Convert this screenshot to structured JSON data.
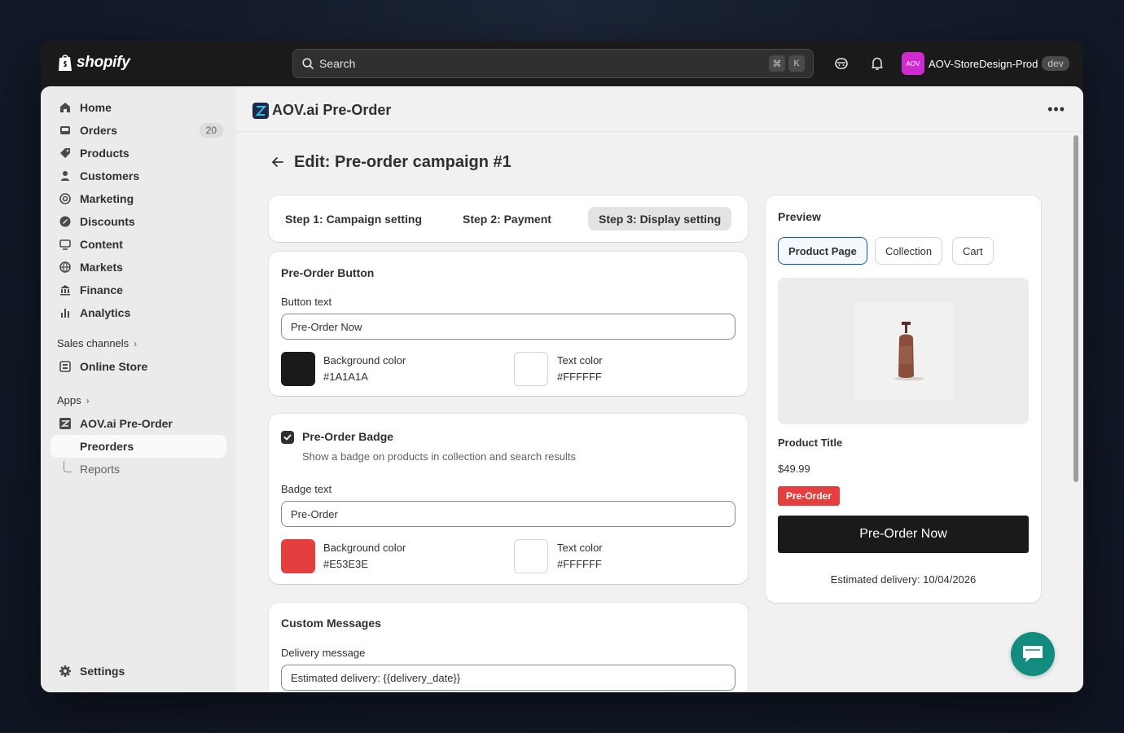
{
  "topbar": {
    "brand": "shopify",
    "search_placeholder": "Search",
    "shortcut_keys": [
      "⌘",
      "K"
    ],
    "store_avatar_text": "AOV",
    "store_name": "AOV-StoreDesign-Prod",
    "store_tag": "dev"
  },
  "sidebar": {
    "items": [
      {
        "label": "Home",
        "icon": "home-icon"
      },
      {
        "label": "Orders",
        "icon": "inbox-icon",
        "count": "20"
      },
      {
        "label": "Products",
        "icon": "tag-icon"
      },
      {
        "label": "Customers",
        "icon": "person-icon"
      },
      {
        "label": "Marketing",
        "icon": "target-icon"
      },
      {
        "label": "Discounts",
        "icon": "discount-icon"
      },
      {
        "label": "Content",
        "icon": "monitor-icon"
      },
      {
        "label": "Markets",
        "icon": "globe-icon"
      },
      {
        "label": "Finance",
        "icon": "bank-icon"
      },
      {
        "label": "Analytics",
        "icon": "bar-chart-icon"
      }
    ],
    "sales_channels_label": "Sales channels",
    "online_store_label": "Online Store",
    "apps_label": "Apps",
    "app_label": "AOV.ai Pre-Order",
    "preorders_label": "Preorders",
    "reports_label": "Reports",
    "settings_label": "Settings"
  },
  "app_header": {
    "title": "AOV.ai Pre-Order"
  },
  "page": {
    "title": "Edit: Pre-order campaign #1",
    "steps": [
      "Step 1: Campaign setting",
      "Step 2: Payment",
      "Step 3: Display setting"
    ],
    "active_step": 2
  },
  "preorder_button": {
    "title": "Pre-Order Button",
    "button_text_label": "Button text",
    "button_text_value": "Pre-Order Now",
    "bg_color_label": "Background color",
    "bg_color_value": "#1A1A1A",
    "text_color_label": "Text color",
    "text_color_value": "#FFFFFF"
  },
  "preorder_badge": {
    "title": "Pre-Order Badge",
    "checked": true,
    "hint": "Show a badge on products in collection and search results",
    "badge_text_label": "Badge text",
    "badge_text_value": "Pre-Order",
    "bg_color_label": "Background color",
    "bg_color_value": "#E53E3E",
    "text_color_label": "Text color",
    "text_color_value": "#FFFFFF"
  },
  "custom_messages": {
    "title": "Custom Messages",
    "delivery_label": "Delivery message",
    "delivery_value": "Estimated delivery: {{delivery_date}}"
  },
  "preview": {
    "title": "Preview",
    "tabs": [
      "Product Page",
      "Collection",
      "Cart"
    ],
    "active_tab": 0,
    "product_title": "Product Title",
    "price": "$49.99",
    "badge": "Pre-Order",
    "button": "Pre-Order Now",
    "delivery": "Estimated delivery: 10/04/2026"
  },
  "colors": {
    "accent_blue": "#005bd3",
    "badge_red": "#E53E3E",
    "button_dark": "#1A1A1A",
    "chat_green": "#128c7e"
  }
}
